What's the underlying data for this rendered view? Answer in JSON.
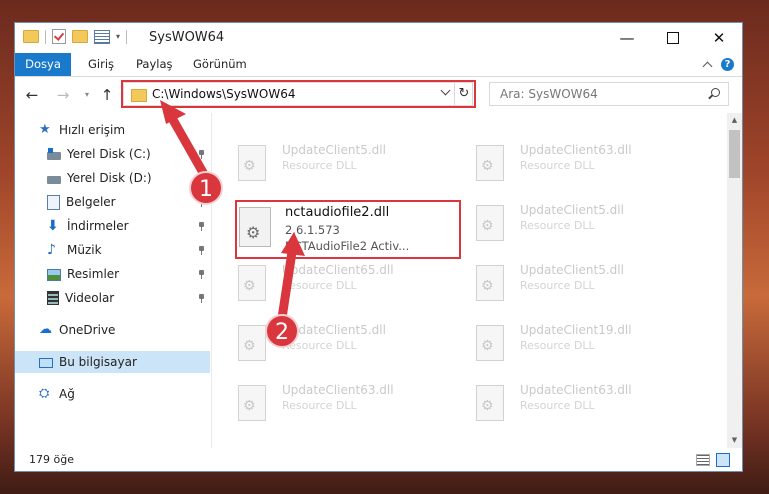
{
  "window": {
    "title": "SysWOW64",
    "controls": {
      "minimize": "—",
      "maximize": "",
      "close": "✕"
    }
  },
  "ribbon": {
    "tabs": [
      {
        "label": "Dosya"
      },
      {
        "label": "Giriş"
      },
      {
        "label": "Paylaş"
      },
      {
        "label": "Görünüm"
      }
    ]
  },
  "address": {
    "path": "C:\\Windows\\SysWOW64",
    "refresh_glyph": "↻"
  },
  "search": {
    "placeholder": "Ara: SysWOW64"
  },
  "nav": {
    "back": "←",
    "forward": "→",
    "up": "↑",
    "recent": "▾",
    "items": [
      {
        "label": "Hızlı erişim",
        "icon": "star-icon",
        "pinned": false
      },
      {
        "label": "Yerel Disk (C:)",
        "icon": "drive-icon",
        "pinned": true
      },
      {
        "label": "Yerel Disk (D:)",
        "icon": "drive-icon",
        "pinned": true
      },
      {
        "label": "Belgeler",
        "icon": "document-icon",
        "pinned": true
      },
      {
        "label": "İndirmeler",
        "icon": "download-icon",
        "pinned": true
      },
      {
        "label": "Müzik",
        "icon": "music-icon",
        "pinned": true
      },
      {
        "label": "Resimler",
        "icon": "pictures-icon",
        "pinned": true
      },
      {
        "label": "Videolar",
        "icon": "videos-icon",
        "pinned": true
      },
      {
        "label": "OneDrive",
        "icon": "cloud-icon",
        "pinned": false
      },
      {
        "label": "Bu bilgisayar",
        "icon": "computer-icon",
        "pinned": false,
        "selected": true
      },
      {
        "label": "Ağ",
        "icon": "network-icon",
        "pinned": false
      }
    ]
  },
  "files": {
    "featured": {
      "name": "nctaudiofile2.dll",
      "version": "2.6.1.573",
      "description": "NCTAudioFile2 Activ..."
    },
    "faded": [
      {
        "name": "UpdateClient5.dll",
        "type": "Resource DLL"
      },
      {
        "name": "UpdateClient63.dll",
        "type": "Resource DLL"
      },
      {
        "name": "UpdateClient5.dll",
        "type": "Resource DLL"
      },
      {
        "name": "UpdateClient65.dll",
        "type": "Resource DLL"
      },
      {
        "name": "UpdateClient5.dll",
        "type": "Resource DLL"
      },
      {
        "name": "UpdateClient5.dll",
        "type": "Resource DLL"
      },
      {
        "name": "UpdateClient19.dll",
        "type": "Resource DLL"
      },
      {
        "name": "UpdateClient63.dll",
        "type": "Resource DLL"
      },
      {
        "name": "UpdateClient63.dll",
        "type": "Resource DLL"
      }
    ]
  },
  "status": {
    "count": "179 öğe"
  },
  "annotations": {
    "step1": "1",
    "step2": "2"
  },
  "colors": {
    "accent": "#1979ca",
    "highlight": "#d9363e",
    "selected": "#cce4f7"
  }
}
